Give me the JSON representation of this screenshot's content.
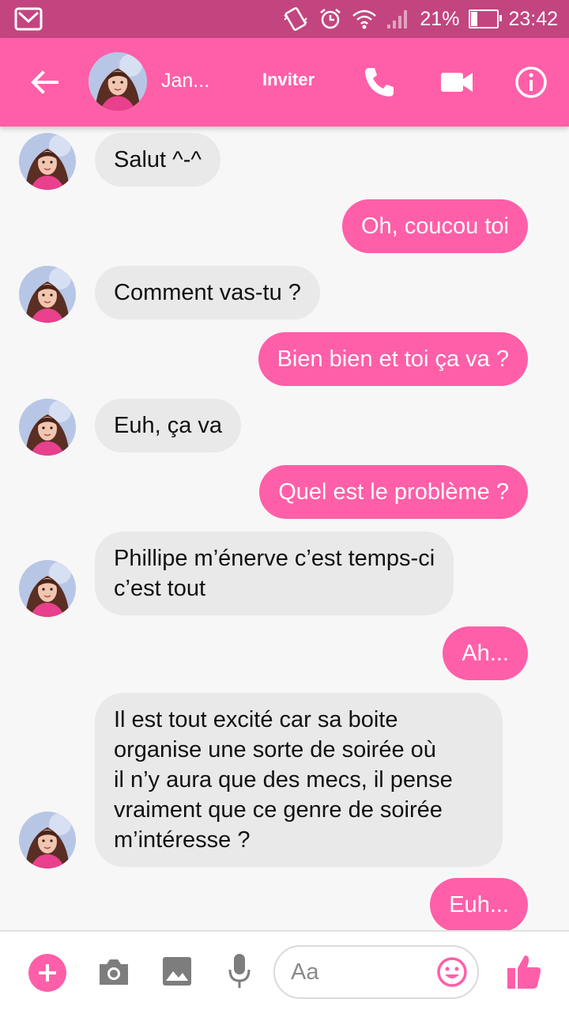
{
  "status_bar": {
    "battery": "21%",
    "battery_level": 0.21,
    "time": "23:42"
  },
  "header": {
    "contact_name": "Jan...",
    "invite_label": "Inviter",
    "accent_color": "#ff5fa8"
  },
  "messages": [
    {
      "from": "contact",
      "text": "Salut ^-^"
    },
    {
      "from": "me",
      "text": "Oh, coucou toi"
    },
    {
      "from": "contact",
      "text": "Comment vas-tu ?"
    },
    {
      "from": "me",
      "text": "Bien bien et toi ça va ?"
    },
    {
      "from": "contact",
      "text": "Euh, ça va"
    },
    {
      "from": "me",
      "text": "Quel est le problème ?"
    },
    {
      "from": "contact",
      "text": "Phillipe m’énerve c’est temps-ci\nc’est tout"
    },
    {
      "from": "me",
      "text": "Ah..."
    },
    {
      "from": "contact",
      "text": "Il est tout excité car sa boite\norganise une sorte de soirée où\nil n’y aura que des mecs, il pense\nvraiment que ce genre de soirée\nm’intéresse ?"
    },
    {
      "from": "me",
      "text": "Euh..."
    }
  ],
  "composer": {
    "placeholder": "Aa",
    "icons": [
      "plus-icon",
      "camera-icon",
      "image-icon",
      "mic-icon",
      "emoji-icon",
      "thumbs-up-icon"
    ]
  }
}
